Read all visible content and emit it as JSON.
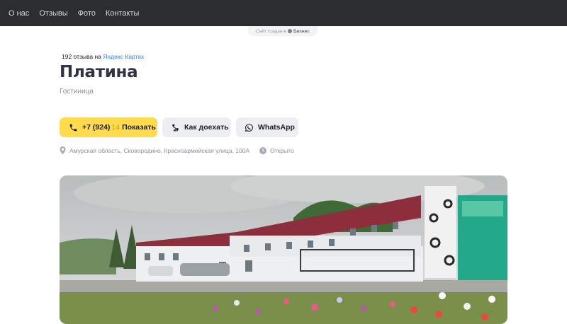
{
  "nav": {
    "items": [
      {
        "label": "О нас"
      },
      {
        "label": "Отзывы"
      },
      {
        "label": "Фото"
      },
      {
        "label": "Контакты"
      }
    ]
  },
  "biz_badge": {
    "prefix": "Сайт создан в",
    "brand": "Бизнес"
  },
  "reviews": {
    "count_text": "192 отзыва на",
    "source": "Яндекс Картах"
  },
  "company": {
    "name": "Платина",
    "category": "Гостиница"
  },
  "actions": {
    "phone": {
      "number": "+7 (924)",
      "hidden_part": "14",
      "reveal_label": "Показать",
      "icon": "phone-icon"
    },
    "route": {
      "label": "Как доехать",
      "icon": "route-icon"
    },
    "whatsapp": {
      "label": "WhatsApp",
      "icon": "whatsapp-icon"
    }
  },
  "info": {
    "address": "Амурская область, Сковородино, Красноармейская улица, 100А",
    "address_icon": "location-pin-icon",
    "status": "Открыто",
    "status_icon": "clock-icon"
  },
  "colors": {
    "nav_bg": "#2b2d31",
    "accent_yellow": "#ffdb4d",
    "secondary_btn": "#eceef2",
    "link_blue": "#3a7bd5",
    "title": "#2f3542"
  }
}
